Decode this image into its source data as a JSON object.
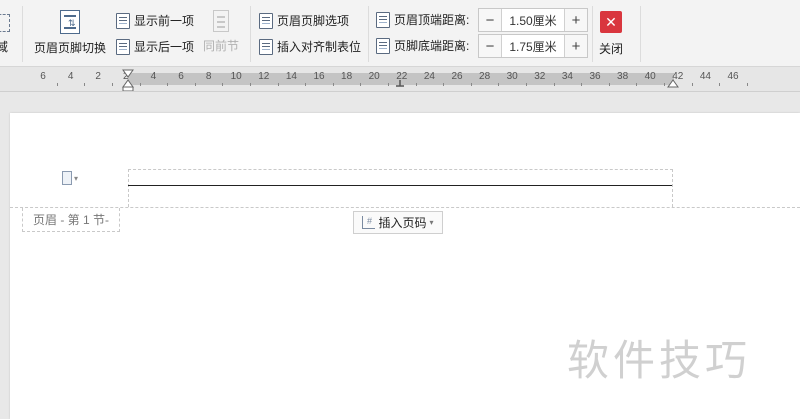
{
  "ribbon": {
    "cut_label": "域",
    "switch_label": "页眉页脚切换",
    "show_prev_label": "显示前一项",
    "show_next_label": "显示后一项",
    "same_as_prev_label": "同前节",
    "options_label": "页眉页脚选项",
    "insert_align_tab_label": "插入对齐制表位",
    "header_top_label": "页眉顶端距离:",
    "header_top_value": "1.50厘米",
    "footer_bottom_label": "页脚底端距离:",
    "footer_bottom_value": "1.75厘米",
    "close_label": "关闭",
    "minus": "−",
    "plus": "+"
  },
  "ruler": {
    "numbers": [
      "6",
      "4",
      "2",
      "2",
      "4",
      "6",
      "8",
      "10",
      "12",
      "14",
      "16",
      "18",
      "20",
      "22",
      "24",
      "26",
      "28",
      "30",
      "32",
      "34",
      "36",
      "38",
      "40",
      "42",
      "44",
      "46"
    ]
  },
  "page": {
    "header_tag": "页眉  - 第 1 节-",
    "insert_page_number": "插入页码"
  },
  "watermark": "软件技巧",
  "colors": {
    "close_red": "#d9363e",
    "ruler_active": "#c4c4c4"
  }
}
